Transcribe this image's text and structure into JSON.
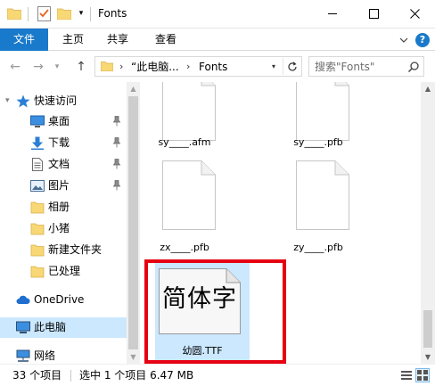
{
  "window": {
    "title": "Fonts",
    "qat_dropdown_glyph": "▾",
    "minimize_glyph": "—",
    "maximize_glyph": "☐",
    "close_glyph": "✕"
  },
  "ribbon": {
    "tabs": [
      {
        "label": "文件"
      },
      {
        "label": "主页"
      },
      {
        "label": "共享"
      },
      {
        "label": "查看"
      }
    ],
    "help_label": "?"
  },
  "address": {
    "segments": [
      "“此电脑...",
      "Fonts"
    ],
    "chevron": "›",
    "search_placeholder": "搜索\"Fonts\""
  },
  "nav": {
    "back_glyph": "←",
    "forward_glyph": "→",
    "recent_glyph": "▾",
    "up_glyph": "↑"
  },
  "navpane": {
    "quick_access": "快速访问",
    "items": [
      {
        "label": "桌面",
        "icon": "desktop-icon",
        "pinned": true
      },
      {
        "label": "下载",
        "icon": "download-icon",
        "pinned": true
      },
      {
        "label": "文档",
        "icon": "documents-icon",
        "pinned": true
      },
      {
        "label": "图片",
        "icon": "pictures-icon",
        "pinned": true
      },
      {
        "label": "相册",
        "icon": "folder-icon",
        "pinned": false
      },
      {
        "label": "小猪",
        "icon": "folder-icon",
        "pinned": false
      },
      {
        "label": "新建文件夹",
        "icon": "folder-icon",
        "pinned": false
      },
      {
        "label": "已处理",
        "icon": "folder-icon",
        "pinned": false
      }
    ],
    "onedrive": "OneDrive",
    "this_pc": "此电脑",
    "network": "网络"
  },
  "files": [
    {
      "name": "sy____.afm"
    },
    {
      "name": "sy____.pfb"
    },
    {
      "name": "zx____.pfb"
    },
    {
      "name": "zy____.pfb"
    },
    {
      "name": "幼圆.TTF",
      "preview": "简体字",
      "selected": true
    }
  ],
  "status": {
    "item_count": "33 个项目",
    "selection": "选中 1 个项目  6.47 MB"
  },
  "colors": {
    "accent": "#1979ca",
    "selection": "#cce8ff",
    "highlight_border": "#e60012",
    "folder": "#f8d775"
  }
}
